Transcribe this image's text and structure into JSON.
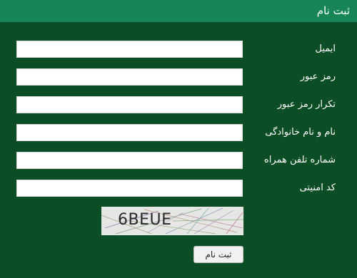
{
  "header": {
    "title": "ثبت نام"
  },
  "form": {
    "fields": [
      {
        "label": "ایمیل",
        "value": ""
      },
      {
        "label": "رمز عبور",
        "value": ""
      },
      {
        "label": "تکرار رمز عبور",
        "value": ""
      },
      {
        "label": "نام و نام خانوادگی",
        "value": ""
      },
      {
        "label": "شماره تلفن همراه",
        "value": ""
      },
      {
        "label": "کد امنیتی",
        "value": ""
      }
    ],
    "captcha_text": "6BEUE",
    "submit_label": "ثبت نام"
  },
  "colors": {
    "background": "#0b4d24",
    "header": "#178556",
    "input": "#ffffff",
    "text": "#ffffff"
  }
}
